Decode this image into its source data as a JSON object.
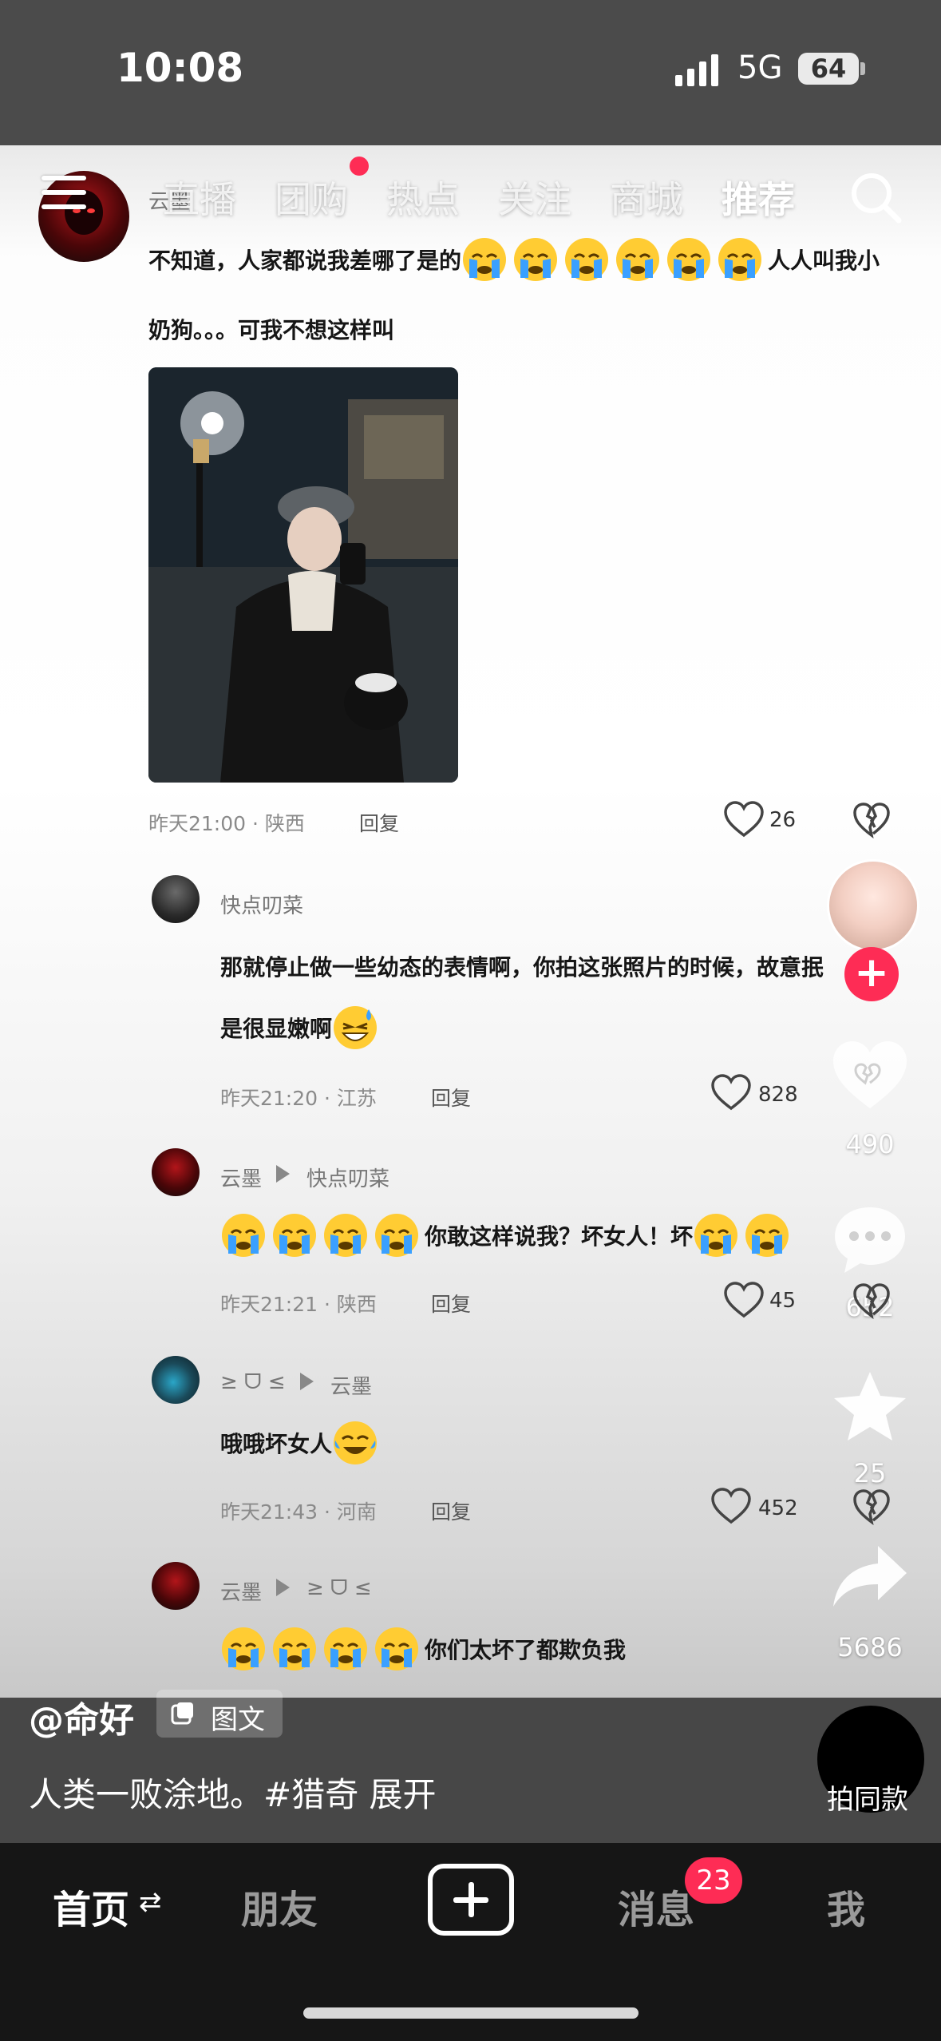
{
  "status_bar": {
    "time": "10:08",
    "network": "5G",
    "battery": "64"
  },
  "top_nav": {
    "tabs": [
      {
        "label": "直播"
      },
      {
        "label": "团购"
      },
      {
        "label": "热点"
      },
      {
        "label": "关注"
      },
      {
        "label": "商城"
      },
      {
        "label": "推荐"
      }
    ]
  },
  "comments": [
    {
      "username": "云墨",
      "text_line1": "不知道，人家都说我差哪了是的",
      "text_line1_end": "人人叫我小",
      "text_line2": "奶狗。。。可我不想这样叫",
      "time": "昨天21:00",
      "location": "陕西",
      "reply": "回复",
      "likes": "26"
    },
    {
      "username": "快点叨菜",
      "text_line1": "那就停止做一些幼态的表情啊，你拍这张照片的时候，故意抿",
      "text_line2": "是很显嫩啊",
      "time": "昨天21:20",
      "location": "江苏",
      "reply": "回复",
      "likes": "828"
    },
    {
      "username": "云墨",
      "reply_to": "快点叨菜",
      "text": "你敢这样说我？坏女人！坏",
      "time": "昨天21:21",
      "location": "陕西",
      "reply": "回复",
      "likes": "45"
    },
    {
      "username": "≥ ᗜ ≤",
      "reply_to": "云墨",
      "text": "哦哦坏女人",
      "time": "昨天21:43",
      "location": "河南",
      "reply": "回复",
      "likes": "452"
    },
    {
      "username": "云墨",
      "reply_to": "≥ ᗜ ≤",
      "text": "你们太坏了都欺负我"
    }
  ],
  "side_actions": {
    "like_count": "490",
    "comment_count": "652",
    "favorite_count": "25",
    "share_count": "5686"
  },
  "caption": {
    "author": "@命好",
    "tag": "图文",
    "text": "人类一败涂地。#猎奇  展开",
    "same_style": "拍同款"
  },
  "tab_bar": {
    "home": "首页",
    "friends": "朋友",
    "messages": "消息",
    "messages_badge": "23",
    "me": "我"
  },
  "colors": {
    "accent": "#fe2c55",
    "tab_bar_bg": "#161616"
  }
}
